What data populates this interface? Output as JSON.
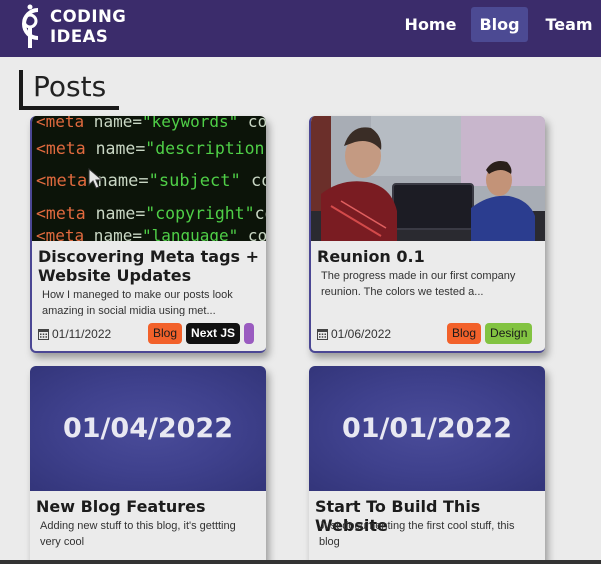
{
  "brand": {
    "line1": "CODING",
    "line2": "IDEAS"
  },
  "nav": {
    "home": "Home",
    "blog": "Blog",
    "team": "Team"
  },
  "page": {
    "title": "Posts"
  },
  "posts": [
    {
      "title": "Discovering Meta tags + Website Updates",
      "excerpt": "How I maneged to make our posts look amazing in social midia using met...",
      "date": "01/11/2022",
      "tags": [
        "Blog",
        "Next JS"
      ],
      "image_code": [
        {
          "tag": "<meta",
          "attr": " name=",
          "val": "\"keywords\"",
          "rest": " conte"
        },
        {
          "tag": "<meta",
          "attr": " name=",
          "val": "\"description\"",
          "rest": " conte"
        },
        {
          "tag": "<meta",
          "attr": " name=",
          "val": "\"subject\"",
          "rest": " conte"
        },
        {
          "tag": "<meta",
          "attr": " name=",
          "val": "\"copyright\"",
          "rest": "conte"
        },
        {
          "tag": "<meta",
          "attr": " name=",
          "val": "\"language\"",
          "rest": " conte"
        }
      ]
    },
    {
      "title": "Reunion 0.1",
      "excerpt": "The progress made in our first company reunion. The colors we tested a...",
      "date": "01/06/2022",
      "tags": [
        "Blog",
        "Design"
      ]
    },
    {
      "title": "New Blog Features",
      "excerpt": "Adding new stuff to this blog, it's gettting very cool",
      "image_date": "01/04/2022"
    },
    {
      "title": "Start To Build This Website",
      "excerpt": "Just documenting the first cool stuff, this blog",
      "image_date": "01/01/2022"
    }
  ],
  "colors": {
    "nav_bg": "#3b2c6b",
    "nav_active": "#4c4a93",
    "tag_blog": "#f2612a",
    "tag_next": "#111111",
    "tag_design": "#82c341",
    "card_border": "#4b4794"
  },
  "icons": {
    "calendar": "calendar-icon",
    "logo": "logo-icon"
  }
}
